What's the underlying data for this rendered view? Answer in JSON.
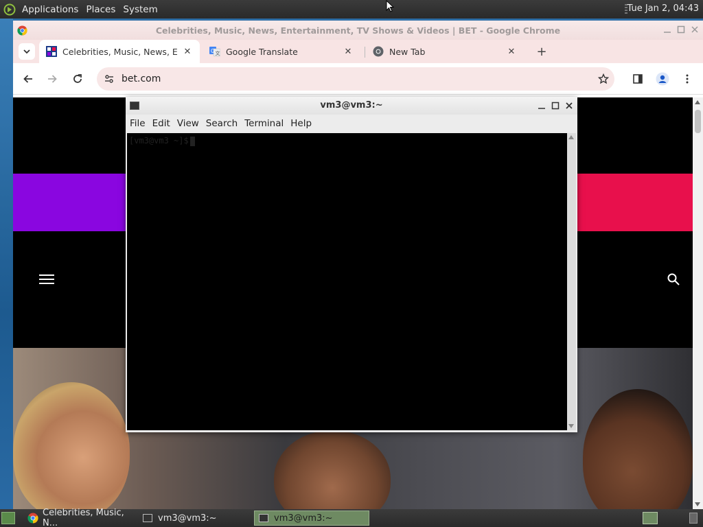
{
  "top_panel": {
    "menus": [
      "Applications",
      "Places",
      "System"
    ],
    "clock": "Tue Jan  2, 04:43"
  },
  "browser": {
    "window_title": "Celebrities, Music, News, Entertainment, TV Shows & Videos | BET - Google Chrome",
    "tabs": [
      {
        "label": "Celebrities, Music, News, Ent",
        "favicon": "bet-favicon",
        "active": true
      },
      {
        "label": "Google Translate",
        "favicon": "google-translate-icon",
        "active": false
      },
      {
        "label": "New Tab",
        "favicon": "chrome-icon",
        "active": false
      }
    ],
    "url": "bet.com"
  },
  "page": {
    "colors": {
      "band_left": "#8a06e0",
      "band_right": "#e8104c"
    }
  },
  "terminal": {
    "title": "vm3@vm3:~",
    "menus": [
      "File",
      "Edit",
      "View",
      "Search",
      "Terminal",
      "Help"
    ],
    "prompt": "[vm3@vm3 ~]$"
  },
  "taskbar": {
    "tasks": [
      {
        "label": "Celebrities, Music, N...",
        "icon": "chrome-icon"
      },
      {
        "label": "vm3@vm3:~",
        "icon": "terminal-icon"
      },
      {
        "label": "vm3@vm3:~",
        "icon": "terminal-icon",
        "active": true
      }
    ]
  }
}
